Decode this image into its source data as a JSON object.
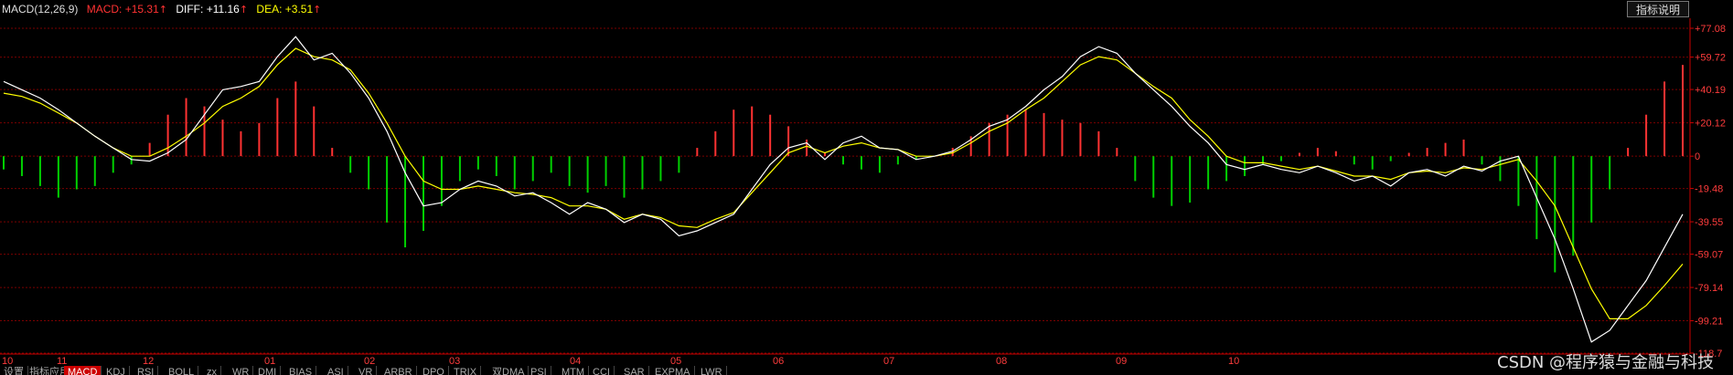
{
  "header": {
    "indicator": "MACD(12,26,9)",
    "macd_label": "MACD:",
    "macd_value": "+15.31",
    "diff_label": "DIFF:",
    "diff_value": "+11.16",
    "dea_label": "DEA:",
    "dea_value": "+3.51",
    "arrow": "↑"
  },
  "help_button": "指标说明",
  "watermark": "CSDN @程序猿与金融与科技",
  "colors": {
    "background": "#000000",
    "positive": "#ff3232",
    "negative": "#00d000",
    "diff_line": "#ffffff",
    "dea_line": "#ffff00",
    "axis_text": "#ff3c3c",
    "grid": "#7a0000"
  },
  "tabs": [
    "设置",
    "指标应用",
    "MACD",
    "KDJ",
    "RSI",
    "BOLL",
    "zx",
    "WR",
    "DMI",
    "BIAS",
    "ASI",
    "VR",
    "ARBR",
    "DPO",
    "TRIX",
    "双DMA",
    "PSI",
    "MTM",
    "CCI",
    "SAR",
    "EXPMA",
    "LWR"
  ],
  "active_tab": "MACD",
  "chart_data": {
    "type": "line",
    "title": "MACD(12,26,9)",
    "grid": true,
    "ylim": [
      -118.7,
      77.08
    ],
    "y_ticks": [
      "+77.08",
      "+59.72",
      "+40.19",
      "+20.12",
      "0",
      "-19.48",
      "-39.55",
      "-59.07",
      "-79.14",
      "-99.21",
      "-118.7"
    ],
    "x_ticks": [
      "10",
      "11",
      "12",
      "01",
      "02",
      "03",
      "04",
      "05",
      "06",
      "07",
      "08",
      "09",
      "10"
    ],
    "diff": [
      45,
      40,
      35,
      28,
      20,
      12,
      5,
      -2,
      -3,
      2,
      10,
      25,
      40,
      42,
      45,
      60,
      72,
      58,
      62,
      50,
      35,
      15,
      -10,
      -30,
      -28,
      -20,
      -15,
      -18,
      -24,
      -22,
      -28,
      -35,
      -28,
      -32,
      -40,
      -35,
      -38,
      -48,
      -45,
      -40,
      -35,
      -20,
      -5,
      5,
      8,
      -2,
      8,
      12,
      5,
      4,
      -2,
      0,
      3,
      10,
      18,
      22,
      30,
      40,
      48,
      60,
      66,
      62,
      50,
      40,
      30,
      18,
      8,
      -5,
      -8,
      -5,
      -8,
      -10,
      -6,
      -10,
      -15,
      -12,
      -18,
      -10,
      -8,
      -12,
      -6,
      -9,
      -3,
      0,
      -25,
      -50,
      -80,
      -112,
      -105,
      -90,
      -75,
      -55,
      -35
    ],
    "dea": [
      38,
      36,
      32,
      26,
      20,
      12,
      5,
      0,
      0,
      5,
      12,
      20,
      30,
      35,
      42,
      55,
      65,
      60,
      58,
      52,
      38,
      20,
      0,
      -15,
      -20,
      -20,
      -18,
      -20,
      -22,
      -23,
      -25,
      -30,
      -30,
      -32,
      -38,
      -35,
      -37,
      -42,
      -43,
      -38,
      -34,
      -22,
      -10,
      2,
      6,
      2,
      6,
      8,
      5,
      4,
      0,
      0,
      2,
      8,
      15,
      20,
      28,
      35,
      45,
      55,
      60,
      58,
      50,
      42,
      35,
      22,
      12,
      0,
      -4,
      -4,
      -6,
      -8,
      -6,
      -9,
      -12,
      -12,
      -14,
      -10,
      -9,
      -10,
      -7,
      -8,
      -5,
      -2,
      -15,
      -30,
      -55,
      -80,
      -98,
      -98,
      -90,
      -78,
      -65
    ],
    "macd": [
      -8,
      -12,
      -18,
      -25,
      -20,
      -18,
      -10,
      -5,
      8,
      25,
      35,
      30,
      22,
      15,
      20,
      35,
      45,
      30,
      5,
      -10,
      -20,
      -40,
      -55,
      -45,
      -30,
      -15,
      -8,
      -12,
      -20,
      -15,
      -10,
      -18,
      -22,
      -18,
      -25,
      -20,
      -15,
      -10,
      5,
      15,
      28,
      30,
      25,
      18,
      10,
      2,
      -5,
      -8,
      -10,
      -5,
      -2,
      0,
      5,
      12,
      20,
      25,
      28,
      26,
      22,
      20,
      15,
      5,
      -15,
      -25,
      -30,
      -28,
      -20,
      -15,
      -12,
      -5,
      -3,
      2,
      5,
      3,
      -5,
      -8,
      -3,
      2,
      5,
      8,
      10,
      -5,
      -15,
      -30,
      -50,
      -70,
      -60,
      -40,
      -20,
      5,
      25,
      45,
      55
    ]
  }
}
